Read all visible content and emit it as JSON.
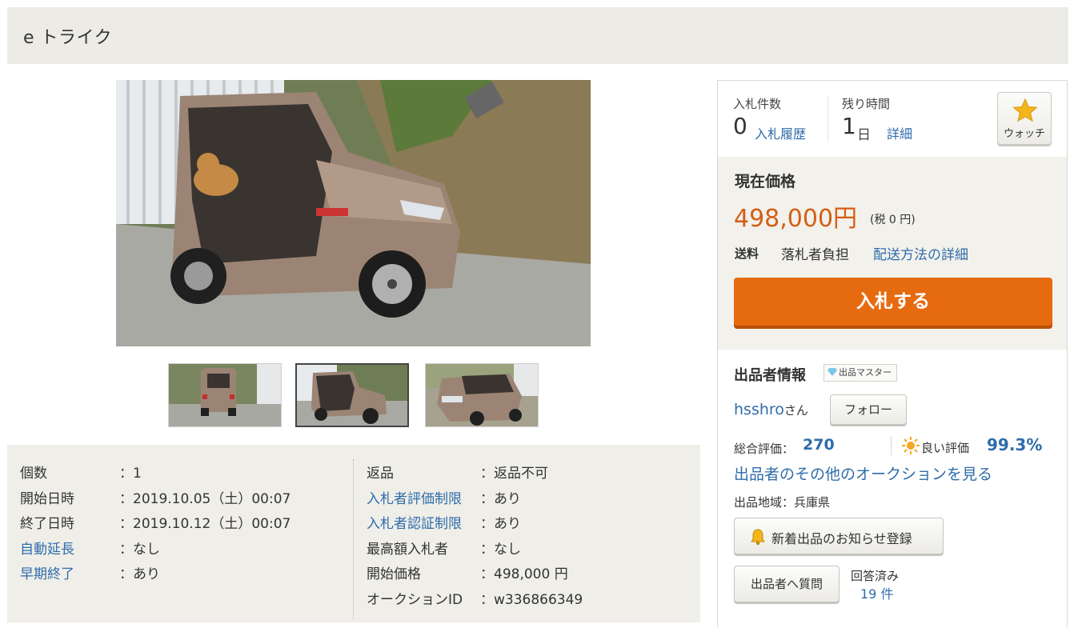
{
  "page": {
    "title": "e トライク"
  },
  "images": {
    "main_alt": "e トライク",
    "thumbnails": [
      "thumb-rear",
      "thumb-side",
      "thumb-front"
    ]
  },
  "info": {
    "left": [
      {
        "label": "個数",
        "value": "：1",
        "link": false
      },
      {
        "label": "開始日時",
        "value": "：2019.10.05（土）00:07",
        "link": false
      },
      {
        "label": "終了日時",
        "value": "：2019.10.12（土）00:07",
        "link": false
      },
      {
        "label": "自動延長",
        "value": "：なし",
        "link": true
      },
      {
        "label": "早期終了",
        "value": "：あり",
        "link": true
      }
    ],
    "right": [
      {
        "label": "返品",
        "value": "：返品不可",
        "link": false
      },
      {
        "label": "入札者評価制限",
        "value": "：あり",
        "link": true
      },
      {
        "label": "入札者認証制限",
        "value": "：あり",
        "link": true
      },
      {
        "label": "最高額入札者",
        "value": "：なし",
        "link": false
      },
      {
        "label": "開始価格",
        "value": "：498,000 円",
        "link": false
      },
      {
        "label": "オークションID",
        "value": "：w336866349",
        "link": false
      }
    ]
  },
  "bid_status": {
    "bids_label": "入札件数",
    "bids_count": "0",
    "bids_history_link": "入札履歴",
    "time_label": "残り時間",
    "time_value": "1",
    "time_unit": "日",
    "time_detail_link": "詳細",
    "watch_label": "ウォッチ"
  },
  "price": {
    "title": "現在価格",
    "value": "498,000円",
    "tax": "(税 0 円)",
    "shipping_label": "送料",
    "shipping_value": "落札者負担",
    "shipping_link": "配送方法の詳細",
    "bid_button": "入札する"
  },
  "seller": {
    "title": "出品者情報",
    "badge": "出品マスター",
    "name": "hsshro",
    "honorific": "さん",
    "follow_button": "フォロー",
    "rating_label": "総合評価：",
    "rating_value": "270",
    "good_label": "良い評価",
    "good_value": "99.3%",
    "other_auctions_link": "出品者のその他のオークションを見る",
    "region": "出品地域：兵庫県",
    "notify_button": "新着出品のお知らせ登録",
    "question_button": "出品者へ質問",
    "answered_label": "回答済み",
    "answered_count": "19 件"
  },
  "colors": {
    "accent_orange": "#e66b10",
    "price_orange": "#d55e12",
    "link_blue": "#2f6cab",
    "panel_beige": "#efeee8"
  }
}
